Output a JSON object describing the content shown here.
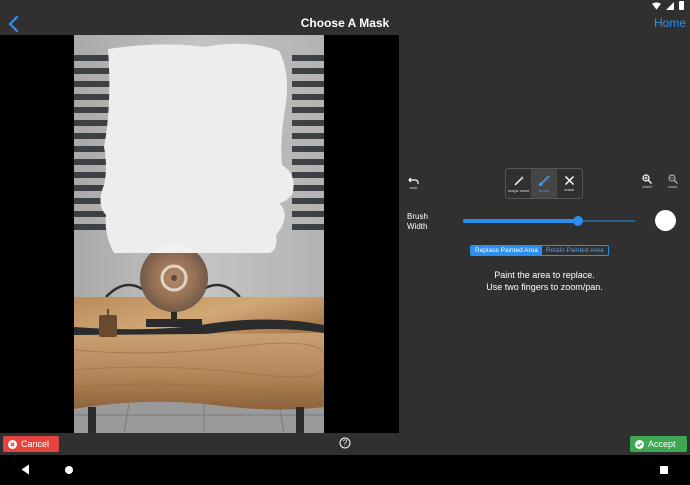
{
  "header": {
    "title": "Choose A Mask",
    "home_label": "Home"
  },
  "toolbar": {
    "undo_label": "undo",
    "zoom_in_label": "zoom+",
    "zoom_out_label": "zoom-",
    "tools": [
      {
        "label": "magic wand",
        "icon": "magic-wand-icon",
        "active": false
      },
      {
        "label": "brush",
        "icon": "brush-icon",
        "active": true
      },
      {
        "label": "erase",
        "icon": "close-icon",
        "active": false
      }
    ]
  },
  "brush": {
    "label_line1": "Brush",
    "label_line2": "Width",
    "width_fraction": 0.67
  },
  "mode": {
    "options": [
      "Replace Painted Area",
      "Retain Painted Area"
    ],
    "selected": 0
  },
  "instructions": {
    "line1": "Paint the area to replace.",
    "line2": "Use two fingers to zoom/pan."
  },
  "footer": {
    "cancel_label": "Cancel",
    "accept_label": "Accept"
  },
  "colors": {
    "accent": "#2d8ef0",
    "cancel": "#e5443e",
    "accept": "#3fa652",
    "background": "#303030"
  }
}
